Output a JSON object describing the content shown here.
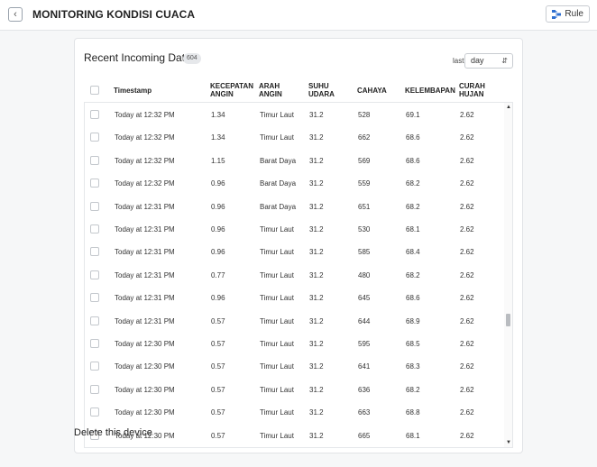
{
  "header": {
    "title": "MONITORING KONDISI CUACA",
    "rule_label": "Rule"
  },
  "card": {
    "title": "Recent Incoming Data",
    "count": "604",
    "last_label": "last",
    "period_value": "day",
    "columns": [
      "Timestamp",
      "KECEPATAN ANGIN",
      "ARAH ANGIN",
      "SUHU UDARA",
      "CAHAYA",
      "KELEMBAPAN",
      "CURAH HUJAN"
    ],
    "rows": [
      [
        "Today at 12:32 PM",
        "1.34",
        "Timur Laut",
        "31.2",
        "528",
        "69.1",
        "2.62"
      ],
      [
        "Today at 12:32 PM",
        "1.34",
        "Timur Laut",
        "31.2",
        "662",
        "68.6",
        "2.62"
      ],
      [
        "Today at 12:32 PM",
        "1.15",
        "Barat Daya",
        "31.2",
        "569",
        "68.6",
        "2.62"
      ],
      [
        "Today at 12:32 PM",
        "0.96",
        "Barat Daya",
        "31.2",
        "559",
        "68.2",
        "2.62"
      ],
      [
        "Today at 12:31 PM",
        "0.96",
        "Barat Daya",
        "31.2",
        "651",
        "68.2",
        "2.62"
      ],
      [
        "Today at 12:31 PM",
        "0.96",
        "Timur Laut",
        "31.2",
        "530",
        "68.1",
        "2.62"
      ],
      [
        "Today at 12:31 PM",
        "0.96",
        "Timur Laut",
        "31.2",
        "585",
        "68.4",
        "2.62"
      ],
      [
        "Today at 12:31 PM",
        "0.77",
        "Timur Laut",
        "31.2",
        "480",
        "68.2",
        "2.62"
      ],
      [
        "Today at 12:31 PM",
        "0.96",
        "Timur Laut",
        "31.2",
        "645",
        "68.6",
        "2.62"
      ],
      [
        "Today at 12:31 PM",
        "0.57",
        "Timur Laut",
        "31.2",
        "644",
        "68.9",
        "2.62"
      ],
      [
        "Today at 12:30 PM",
        "0.57",
        "Timur Laut",
        "31.2",
        "595",
        "68.5",
        "2.62"
      ],
      [
        "Today at 12:30 PM",
        "0.57",
        "Timur Laut",
        "31.2",
        "641",
        "68.3",
        "2.62"
      ],
      [
        "Today at 12:30 PM",
        "0.57",
        "Timur Laut",
        "31.2",
        "636",
        "68.2",
        "2.62"
      ],
      [
        "Today at 12:30 PM",
        "0.57",
        "Timur Laut",
        "31.2",
        "663",
        "68.8",
        "2.62"
      ],
      [
        "Today at 12:30 PM",
        "0.57",
        "Timur Laut",
        "31.2",
        "665",
        "68.1",
        "2.62"
      ]
    ]
  },
  "footer": {
    "delete_title": "Delete this device"
  },
  "icons": {
    "back": "chevron-left-icon",
    "rule": "rule-flow-icon",
    "select": "sort-arrows-icon"
  },
  "colors": {
    "rule_icon": "#2f6fd0"
  }
}
